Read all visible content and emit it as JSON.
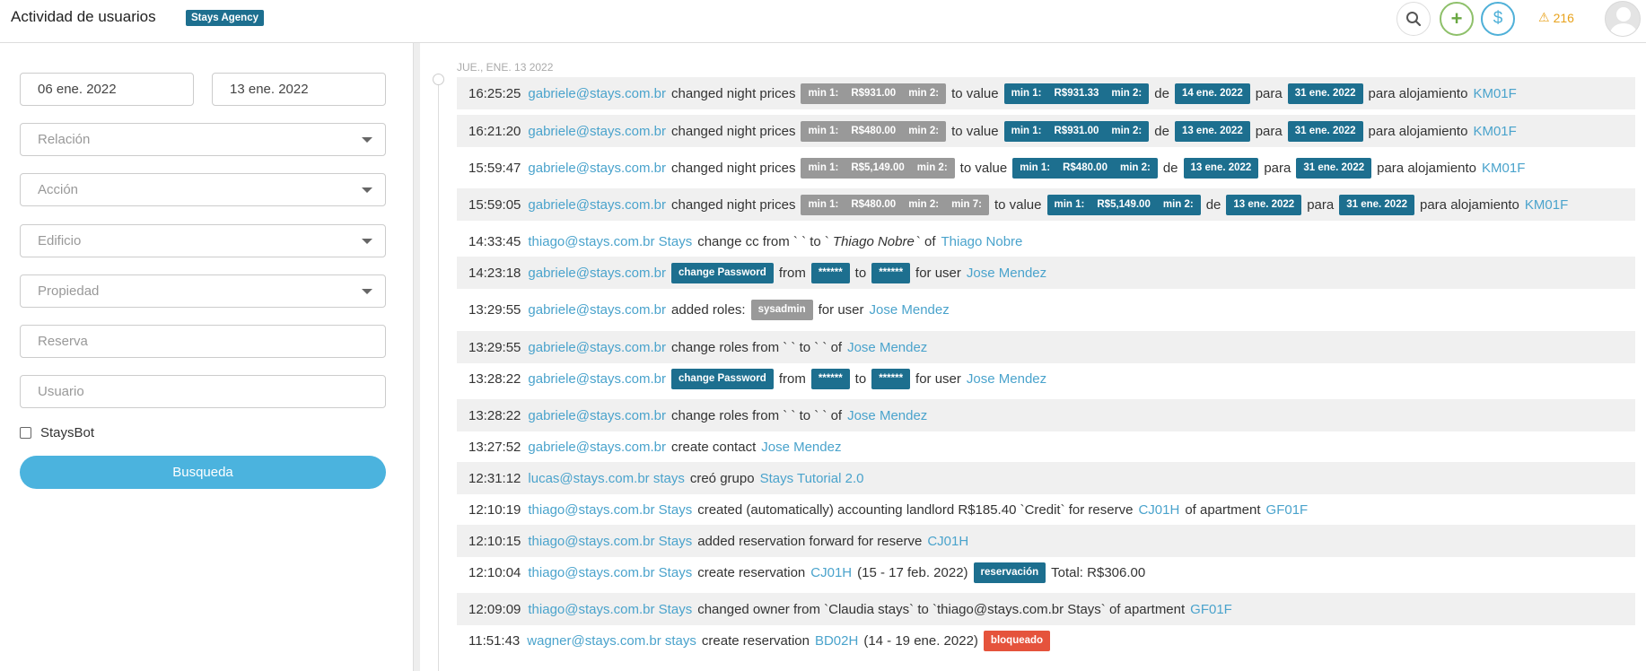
{
  "header": {
    "title": "Actividad de usuarios",
    "agency_badge": "Stays Agency",
    "alert_count": "216",
    "add_symbol": "+",
    "money_symbol": "$",
    "alert_symbol": "⚠"
  },
  "filters": {
    "date_from": "06 ene. 2022",
    "date_to": "13 ene. 2022",
    "relacion_placeholder": "Relación",
    "accion_placeholder": "Acción",
    "edificio_placeholder": "Edificio",
    "propiedad_placeholder": "Propiedad",
    "reserva_placeholder": "Reserva",
    "usuario_placeholder": "Usuario",
    "staysbot_label": "StaysBot",
    "search_button": "Busqueda"
  },
  "timeline": {
    "date_header": "JUE., ENE. 13 2022",
    "rows": [
      {
        "time": "16:25:25",
        "user": "gabriele@stays.com.br",
        "t1": "changed night prices",
        "old_min1": "min 1:",
        "old_val1": "R$931.00",
        "old_min2": "min 2:",
        "t2": "to value",
        "new_min1": "min 1:",
        "new_val1": "R$931.33",
        "new_min2": "min 2:",
        "t3": "de",
        "from_date": "14 ene. 2022",
        "t4": "para",
        "to_date": "31 ene. 2022",
        "t5": "para alojamiento",
        "listing": "KM01F"
      },
      {
        "time": "16:21:20",
        "user": "gabriele@stays.com.br",
        "t1": "changed night prices",
        "old_min1": "min 1:",
        "old_val1": "R$480.00",
        "old_min2": "min 2:",
        "t2": "to value",
        "new_min1": "min 1:",
        "new_val1": "R$931.00",
        "new_min2": "min 2:",
        "t3": "de",
        "from_date": "13 ene. 2022",
        "t4": "para",
        "to_date": "31 ene. 2022",
        "t5": "para alojamiento",
        "listing": "KM01F"
      },
      {
        "time": "15:59:47",
        "user": "gabriele@stays.com.br",
        "t1": "changed night prices",
        "old_min1": "min 1:",
        "old_val1": "R$5,149.00",
        "old_min2": "min 2:",
        "t2": "to value",
        "new_min1": "min 1:",
        "new_val1": "R$480.00",
        "new_min2": "min 2:",
        "t3": "de",
        "from_date": "13 ene. 2022",
        "t4": "para",
        "to_date": "31 ene. 2022",
        "t5": "para alojamiento",
        "listing": "KM01F"
      },
      {
        "time": "15:59:05",
        "user": "gabriele@stays.com.br",
        "t1": "changed night prices",
        "old_min1": "min 1:",
        "old_val1": "R$480.00",
        "old_min2": "min 2:",
        "old_min7": "min 7:",
        "t2": "to value",
        "new_min1": "min 1:",
        "new_val1": "R$5,149.00",
        "new_min2": "min 2:",
        "t3": "de",
        "from_date": "13 ene. 2022",
        "t4": "para",
        "to_date": "31 ene. 2022",
        "t5": "para alojamiento",
        "listing": "KM01F"
      },
      {
        "time": "14:33:45",
        "user": "thiago@stays.com.br Stays",
        "t1": "change cc from ` ` to `",
        "em": "Thiago Nobre",
        "t2": "` of",
        "target": "Thiago Nobre"
      },
      {
        "time": "14:23:18",
        "user": "gabriele@stays.com.br",
        "chip": "change Password",
        "t1": "from",
        "mask1": "******",
        "t2": "to",
        "mask2": "******",
        "t3": "for user",
        "target": "Jose Mendez"
      },
      {
        "time": "13:29:55",
        "user": "gabriele@stays.com.br",
        "t1": "added roles:",
        "chip": "sysadmin",
        "t2": "for user",
        "target": "Jose Mendez"
      },
      {
        "time": "13:29:55",
        "user": "gabriele@stays.com.br",
        "t1": "change roles from ` ` to ` ` of",
        "target": "Jose Mendez"
      },
      {
        "time": "13:28:22",
        "user": "gabriele@stays.com.br",
        "chip": "change Password",
        "t1": "from",
        "mask1": "******",
        "t2": "to",
        "mask2": "******",
        "t3": "for user",
        "target": "Jose Mendez"
      },
      {
        "time": "13:28:22",
        "user": "gabriele@stays.com.br",
        "t1": "change roles from ` ` to ` ` of",
        "target": "Jose Mendez"
      },
      {
        "time": "13:27:52",
        "user": "gabriele@stays.com.br",
        "t1": "create contact",
        "target": "Jose Mendez"
      },
      {
        "time": "12:31:12",
        "user": "lucas@stays.com.br stays",
        "t1": "creó grupo",
        "target": "Stays Tutorial 2.0"
      },
      {
        "time": "12:10:19",
        "user": "thiago@stays.com.br Stays",
        "t1": "created (automatically) accounting landlord R$185.40 `Credit` for reserve",
        "reserve": "CJ01H",
        "t2": "of apartment",
        "apartment": "GF01F"
      },
      {
        "time": "12:10:15",
        "user": "thiago@stays.com.br Stays",
        "t1": "added reservation forward for reserve",
        "reserve": "CJ01H"
      },
      {
        "time": "12:10:04",
        "user": "thiago@stays.com.br Stays",
        "t1": "create reservation",
        "reserve": "CJ01H",
        "t2": "(15 - 17 feb. 2022)",
        "chip": "reservación",
        "t3": "Total: R$306.00"
      },
      {
        "time": "12:09:09",
        "user": "thiago@stays.com.br Stays",
        "t1": "changed owner from `Claudia stays` to `thiago@stays.com.br Stays` of apartment",
        "apartment": "GF01F"
      },
      {
        "time": "11:51:43",
        "user": "wagner@stays.com.br stays",
        "t1": "create reservation",
        "reserve": "BD02H",
        "t2": "(14 - 19 ene. 2022)",
        "chip": "bloqueado"
      }
    ]
  }
}
